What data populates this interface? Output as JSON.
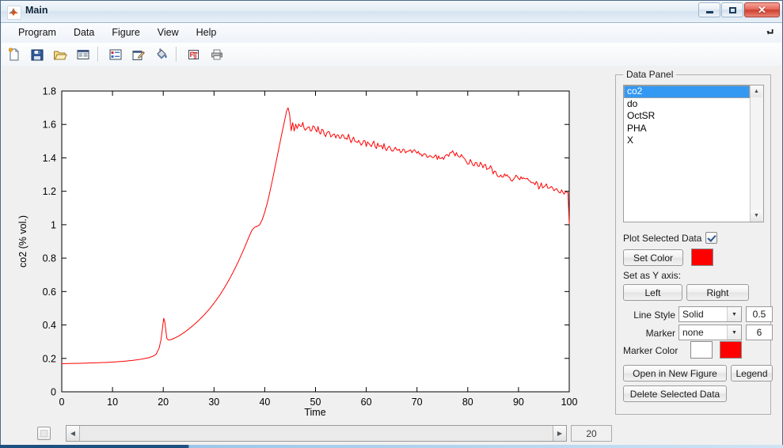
{
  "window": {
    "title": "Main",
    "icon": "matlab-logo-icon",
    "buttons": {
      "minimize": "minimize-icon",
      "maximize": "maximize-icon",
      "close": "close-icon"
    }
  },
  "menubar": {
    "items": [
      {
        "label": "Program"
      },
      {
        "label": "Data"
      },
      {
        "label": "Figure"
      },
      {
        "label": "View"
      },
      {
        "label": "Help"
      }
    ],
    "dock_icon": "undock-arrow-icon"
  },
  "toolbar": {
    "buttons": [
      {
        "name": "new-file-button",
        "icon": "new-document-icon"
      },
      {
        "name": "save-button",
        "icon": "floppy-disk-icon"
      },
      {
        "name": "open-button",
        "icon": "open-folder-icon"
      },
      {
        "name": "table-view-button",
        "icon": "table-window-icon"
      },
      {
        "name": "list-properties-button",
        "icon": "list-detail-icon"
      },
      {
        "name": "edit-properties-button",
        "icon": "edit-pencil-icon"
      },
      {
        "name": "fill-color-button",
        "icon": "paint-bucket-icon"
      },
      {
        "name": "export-fig-button",
        "icon": "fig-export-icon"
      },
      {
        "name": "print-button",
        "icon": "printer-icon"
      }
    ]
  },
  "bottom": {
    "checkbox_checked": false,
    "slider_value": "20",
    "left_arrow": "◀",
    "right_arrow": "▶"
  },
  "panel": {
    "title": "Data Panel",
    "list": {
      "items": [
        "co2",
        "do",
        "OctSR",
        "PHA",
        "X"
      ],
      "selected_index": 0,
      "scroll_up": "▲",
      "scroll_down": "▼"
    },
    "plot_selected_label": "Plot Selected Data",
    "plot_selected_checked": true,
    "set_color_label": "Set Color",
    "set_color_value": "#FF0000",
    "y_axis_label": "Set as Y axis:",
    "left_button": "Left",
    "right_button": "Right",
    "line_style_label": "Line Style",
    "line_style_value": "Solid",
    "line_width_value": "0.5",
    "marker_label": "Marker",
    "marker_value": "none",
    "marker_size_value": "6",
    "marker_color_label": "Marker Color",
    "marker_face_color": "#FFFFFF",
    "marker_edge_color": "#FF0000",
    "open_new_figure_button": "Open in New Figure",
    "legend_button": "Legend",
    "delete_data_button": "Delete Selected Data",
    "combo_arrow": "▼"
  },
  "chart_data": {
    "type": "line",
    "title": "",
    "xlabel": "Time",
    "ylabel": "co2 (% vol.)",
    "xlim": [
      0,
      100
    ],
    "ylim": [
      0,
      1.8
    ],
    "xticks": [
      0,
      10,
      20,
      30,
      40,
      50,
      60,
      70,
      80,
      90,
      100
    ],
    "yticks": [
      0,
      0.2,
      0.4,
      0.6,
      0.8,
      1,
      1.2,
      1.4,
      1.6,
      1.8
    ],
    "xticklabels": [
      "0",
      "10",
      "20",
      "30",
      "40",
      "50",
      "60",
      "70",
      "80",
      "90",
      "100"
    ],
    "yticklabels": [
      "0",
      "0.2",
      "0.4",
      "0.6",
      "0.8",
      "1",
      "1.2",
      "1.4",
      "1.6",
      "1.8"
    ],
    "grid": false,
    "legend": null,
    "series": [
      {
        "name": "co2",
        "color": "#FF0000",
        "linewidth": 0.5,
        "linestyle": "Solid",
        "marker": "none",
        "x": [
          0,
          1,
          2,
          3,
          4,
          5,
          6,
          7,
          8,
          9,
          10,
          11,
          12,
          13,
          14,
          15,
          16,
          17,
          18,
          18.6,
          19.2,
          19.6,
          19.9,
          20.1,
          20.3,
          20.5,
          20.7,
          21,
          21.5,
          22,
          23,
          24,
          25,
          26,
          27,
          28,
          29,
          30,
          31,
          32,
          33,
          34,
          35,
          36,
          37,
          37.5,
          38,
          38.5,
          39,
          39.5,
          40,
          40.5,
          41,
          41.5,
          42,
          42.5,
          43,
          43.5,
          44,
          44.3,
          44.6,
          44.9,
          45.2,
          45.5,
          45.8,
          46.1,
          46.4,
          46.7,
          47,
          47.5,
          48,
          48.5,
          49,
          49.5,
          50,
          50.5,
          51,
          51.5,
          52,
          52.5,
          53,
          53.5,
          54,
          54.5,
          55,
          55.5,
          56,
          56.5,
          57,
          57.5,
          58,
          58.5,
          59,
          59.5,
          60,
          60.5,
          61,
          61.5,
          62,
          62.5,
          63,
          63.5,
          64,
          64.5,
          65,
          65.5,
          66,
          66.5,
          67,
          67.5,
          68,
          68.5,
          69,
          69.5,
          70,
          70.5,
          71,
          71.5,
          72,
          72.5,
          73,
          73.5,
          74,
          74.5,
          75,
          75.5,
          76,
          76.5,
          77,
          77.5,
          78,
          78.5,
          79,
          79.5,
          80,
          80.5,
          81,
          81.5,
          82,
          82.5,
          83,
          83.5,
          84,
          84.5,
          85,
          85.5,
          86,
          86.5,
          87,
          87.5,
          88,
          88.5,
          89,
          89.5,
          90,
          90.5,
          91,
          91.5,
          92,
          92.5,
          93,
          93.5,
          94,
          94.5,
          95,
          95.5,
          96,
          96.5,
          97,
          97.5,
          98,
          98.5,
          99,
          99.5,
          100
        ],
        "y": [
          0.168,
          0.169,
          0.17,
          0.17,
          0.171,
          0.172,
          0.173,
          0.174,
          0.175,
          0.176,
          0.178,
          0.18,
          0.182,
          0.185,
          0.188,
          0.192,
          0.197,
          0.203,
          0.213,
          0.225,
          0.262,
          0.32,
          0.395,
          0.44,
          0.42,
          0.37,
          0.32,
          0.31,
          0.312,
          0.318,
          0.333,
          0.352,
          0.375,
          0.4,
          0.428,
          0.458,
          0.492,
          0.53,
          0.572,
          0.62,
          0.672,
          0.73,
          0.793,
          0.862,
          0.935,
          0.968,
          0.985,
          0.99,
          1.0,
          1.03,
          1.075,
          1.13,
          1.195,
          1.265,
          1.34,
          1.415,
          1.49,
          1.565,
          1.635,
          1.68,
          1.692,
          1.66,
          1.575,
          1.6,
          1.57,
          1.61,
          1.575,
          1.6,
          1.58,
          1.6,
          1.572,
          1.59,
          1.565,
          1.585,
          1.56,
          1.58,
          1.55,
          1.568,
          1.54,
          1.56,
          1.532,
          1.552,
          1.525,
          1.545,
          1.518,
          1.535,
          1.51,
          1.528,
          1.502,
          1.52,
          1.495,
          1.512,
          1.488,
          1.505,
          1.48,
          1.498,
          1.472,
          1.49,
          1.466,
          1.482,
          1.46,
          1.476,
          1.452,
          1.47,
          1.446,
          1.462,
          1.44,
          1.456,
          1.434,
          1.45,
          1.428,
          1.444,
          1.422,
          1.438,
          1.416,
          1.432,
          1.41,
          1.425,
          1.404,
          1.418,
          1.4,
          1.41,
          1.404,
          1.398,
          1.406,
          1.4,
          1.412,
          1.42,
          1.428,
          1.418,
          1.426,
          1.412,
          1.4,
          1.382,
          1.366,
          1.38,
          1.358,
          1.372,
          1.348,
          1.362,
          1.338,
          1.352,
          1.328,
          1.342,
          1.318,
          1.304,
          1.29,
          1.305,
          1.282,
          1.298,
          1.274,
          1.262,
          1.278,
          1.29,
          1.276,
          1.288,
          1.268,
          1.28,
          1.258,
          1.248,
          1.236,
          1.25,
          1.228,
          1.242,
          1.22,
          1.232,
          1.21,
          1.222,
          1.2,
          1.212,
          1.19,
          1.202,
          1.18,
          1.192,
          1.17,
          1.182,
          1.158,
          1.17,
          1.148,
          1.16,
          1.136,
          1.148,
          1.124,
          1.136,
          1.112,
          1.124,
          1.1,
          1.112,
          1.09,
          1.102,
          1.078,
          1.09,
          1.066,
          1.078,
          1.054,
          1.066,
          1.042,
          1.054,
          1.032,
          1.044,
          1.022,
          1.034,
          1.012,
          1.004
        ]
      }
    ]
  }
}
